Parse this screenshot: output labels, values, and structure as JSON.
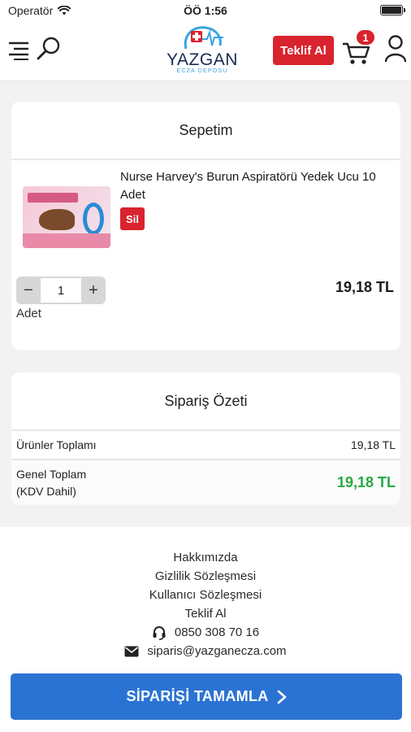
{
  "status_bar": {
    "carrier": "Operatör",
    "time": "ÖÖ 1:56"
  },
  "header": {
    "logo_brand": "YAZGAN",
    "logo_sub": "ECZA DEPOSU",
    "offer_button": "Teklif Al",
    "cart_count": "1"
  },
  "cart": {
    "title": "Sepetim",
    "items": [
      {
        "name": "Nurse Harvey's Burun Aspiratörü Yedek Ucu 10 Adet",
        "delete_label": "Sil",
        "quantity": "1",
        "quantity_unit": "Adet",
        "price": "19,18 TL"
      }
    ],
    "decrement": "−",
    "increment": "+"
  },
  "summary": {
    "title": "Sipariş Özeti",
    "subtotal_label": "Ürünler Toplamı",
    "subtotal_value": "19,18 TL",
    "total_label_line1": "Genel Toplam",
    "total_label_line2": "(KDV Dahil)",
    "total_value": "19,18 TL",
    "total_color": "#27a844"
  },
  "footer": {
    "links": [
      "Hakkımızda",
      "Gizlilik Sözleşmesi",
      "Kullanıcı Sözleşmesi",
      "Teklif Al"
    ],
    "phone": "0850 308 70 16",
    "email": "siparis@yazganecza.com"
  },
  "checkout": {
    "label": "SİPARİŞİ TAMAMLA",
    "color": "#2b73d3"
  },
  "accent": "#d9232e"
}
